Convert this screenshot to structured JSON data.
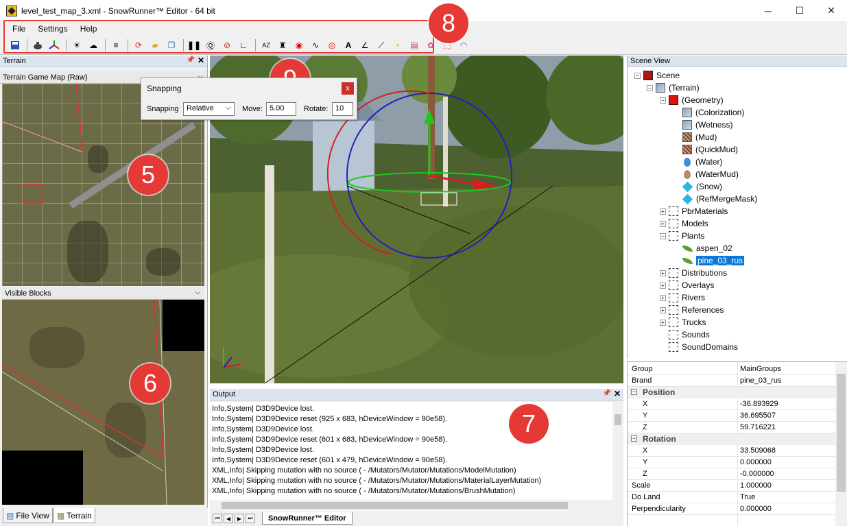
{
  "window": {
    "title": "level_test_map_3.xml - SnowRunner™ Editor - 64 bit",
    "minimize": "─",
    "maximize": "☐",
    "close": "✕"
  },
  "menu": [
    "File",
    "Settings",
    "Help"
  ],
  "callouts": {
    "c8": "8",
    "c9": "9",
    "c5": "5",
    "c6": "6",
    "c7": "7"
  },
  "terrain_panel": {
    "title": "Terrain",
    "map_combo": "Terrain Game Map (Raw)",
    "blocks_combo": "Visible Blocks",
    "tabs": [
      "File View",
      "Terrain"
    ]
  },
  "snapping": {
    "title": "Snapping",
    "close": "x",
    "snapping_label": "Snapping",
    "snapping_value": "Relative",
    "move_label": "Move:",
    "move_value": "5.00",
    "rotate_label": "Rotate:",
    "rotate_value": "10"
  },
  "output": {
    "title": "Output",
    "lines": [
      "Info,System| D3D9Device lost.",
      "Info,System| D3D9Device reset (925 x 683, hDeviceWindow = 90e58).",
      "Info,System| D3D9Device lost.",
      "Info,System| D3D9Device reset (601 x 683, hDeviceWindow = 90e58).",
      "Info,System| D3D9Device lost.",
      "Info,System| D3D9Device reset (601 x 479, hDeviceWindow = 90e58).",
      "XML,Info| Skipping mutation with no source ( - /Mutators/Mutator/Mutations/ModelMutation)",
      "XML,Info| Skipping mutation with no source ( - /Mutators/Mutator/Mutations/MaterialLayerMutation)",
      "XML,Info| Skipping mutation with no source ( - /Mutators/Mutator/Mutations/BrushMutation)"
    ],
    "tab": "SnowRunner™ Editor"
  },
  "scene_view": {
    "title": "Scene View",
    "items": {
      "scene": "Scene",
      "terrain": "(Terrain)",
      "geometry": "(Geometry)",
      "colorization": "(Colorization)",
      "wetness": "(Wetness)",
      "mud": "(Mud)",
      "quickmud": "(QuickMud)",
      "water": "(Water)",
      "watermud": "(WaterMud)",
      "snow": "(Snow)",
      "refmerge": "(RefMergeMask)",
      "pbr": "PbrMaterials",
      "models": "Models",
      "plants": "Plants",
      "aspen": "aspen_02",
      "pine": "pine_03_rus",
      "distributions": "Distributions",
      "overlays": "Overlays",
      "rivers": "Rivers",
      "references": "References",
      "trucks": "Trucks",
      "sounds": "Sounds",
      "sounddomains": "SoundDomains"
    }
  },
  "properties": {
    "group": {
      "name": "Group",
      "value": "MainGroups"
    },
    "brand": {
      "name": "Brand",
      "value": "pine_03_rus"
    },
    "position": "Position",
    "pos_x": {
      "name": "X",
      "value": "-36.893929"
    },
    "pos_y": {
      "name": "Y",
      "value": "36.695507"
    },
    "pos_z": {
      "name": "Z",
      "value": "59.716221"
    },
    "rotation": "Rotation",
    "rot_x": {
      "name": "X",
      "value": "33.509068"
    },
    "rot_y": {
      "name": "Y",
      "value": "0.000000"
    },
    "rot_z": {
      "name": "Z",
      "value": "-0.000000"
    },
    "scale": {
      "name": "Scale",
      "value": "1.000000"
    },
    "doland": {
      "name": "Do Land",
      "value": "True"
    },
    "perp": {
      "name": "Perpendicularity",
      "value": "0.000000"
    }
  },
  "colors": {
    "accent": "#e53935",
    "selection": "#0a78d7",
    "panel_title": "#dbe4ef"
  }
}
